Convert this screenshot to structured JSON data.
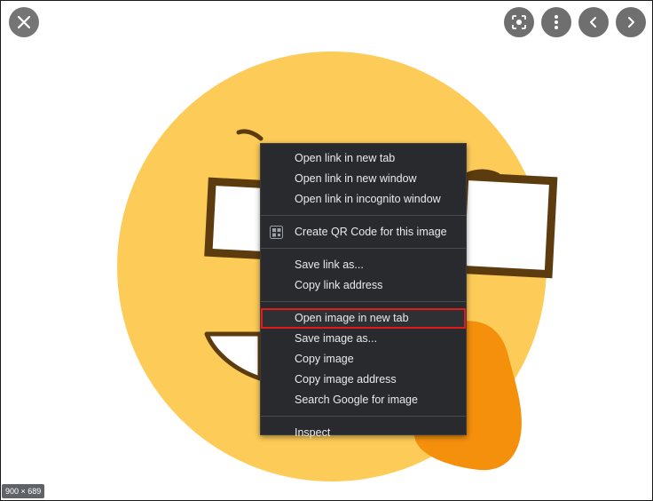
{
  "toolbar": {
    "close_icon": "close-icon",
    "lens_icon": "lens-icon",
    "more_icon": "more-vertical-icon",
    "prev_icon": "chevron-left-icon",
    "next_icon": "chevron-right-icon"
  },
  "image_size": "900 × 689",
  "context_menu": {
    "items": [
      {
        "label": "Open link in new tab"
      },
      {
        "label": "Open link in new window"
      },
      {
        "label": "Open link in incognito window"
      },
      {
        "label": "Create QR Code for this image",
        "icon": "qr-code-icon"
      },
      {
        "label": "Save link as..."
      },
      {
        "label": "Copy link address"
      },
      {
        "label": "Open image in new tab",
        "highlighted": true
      },
      {
        "label": "Save image as..."
      },
      {
        "label": "Copy image"
      },
      {
        "label": "Copy image address"
      },
      {
        "label": "Search Google for image"
      },
      {
        "label": "Inspect"
      }
    ]
  },
  "colors": {
    "emoji_face": "#fdcb58",
    "emoji_outline": "#5c3c0f",
    "orange_blob": "#f4900c",
    "menu_bg": "#292a2d",
    "menu_text": "#e8eaed",
    "highlight_border": "#e01b1b",
    "button_bg": "#6f6f6f"
  }
}
